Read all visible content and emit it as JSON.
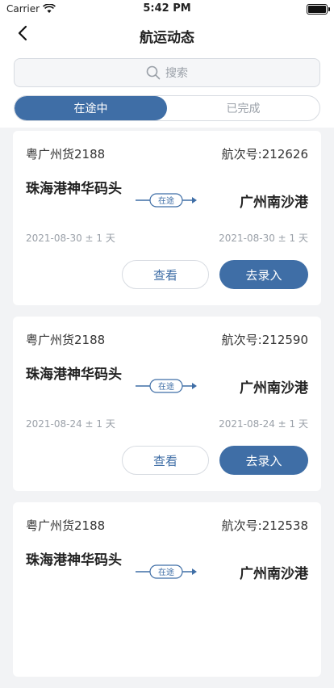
{
  "status_bar": {
    "carrier": "Carrier",
    "time": "5:42 PM"
  },
  "nav": {
    "title": "航运动态"
  },
  "search": {
    "placeholder": "搜索"
  },
  "tabs": [
    {
      "label": "在途中",
      "active": true
    },
    {
      "label": "已完成",
      "active": false
    }
  ],
  "voyages": [
    {
      "ship": "粤广州货2188",
      "voyage_label": "航次号:212626",
      "origin": "珠海港神华码头",
      "destination": "广州南沙港",
      "status": "在途",
      "depart_date": "2021-08-30 ± 1 天",
      "arrive_date": "2021-08-30 ± 1 天",
      "view_label": "查看",
      "entry_label": "去录入"
    },
    {
      "ship": "粤广州货2188",
      "voyage_label": "航次号:212590",
      "origin": "珠海港神华码头",
      "destination": "广州南沙港",
      "status": "在途",
      "depart_date": "2021-08-24 ± 1 天",
      "arrive_date": "2021-08-24 ± 1 天",
      "view_label": "查看",
      "entry_label": "去录入"
    },
    {
      "ship": "粤广州货2188",
      "voyage_label": "航次号:212538",
      "origin": "珠海港神华码头",
      "destination": "广州南沙港",
      "status": "在途",
      "depart_date": "",
      "arrive_date": "",
      "view_label": "",
      "entry_label": ""
    }
  ],
  "colors": {
    "accent": "#3f6ea6",
    "background": "#f2f3f5"
  }
}
